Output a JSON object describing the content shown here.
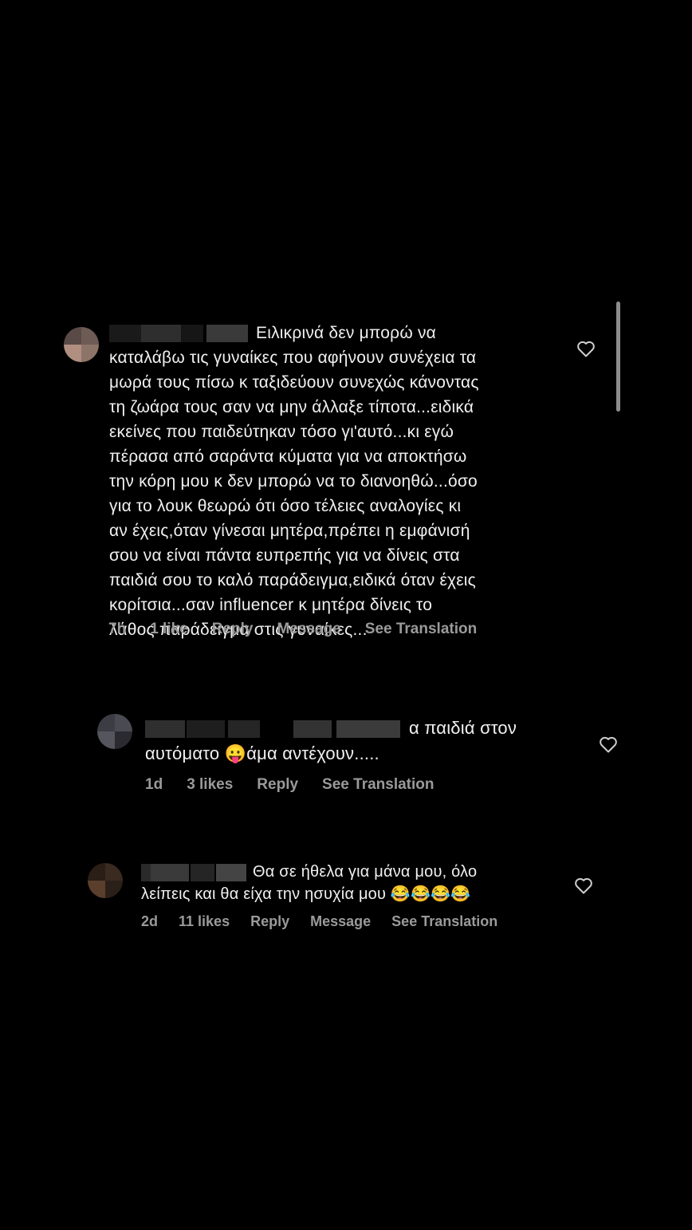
{
  "comments": [
    {
      "text_first": "Ειλικρινά δεν μπορώ να",
      "text_rest": "καταλάβω τις γυναίκες που αφήνουν συνέχεια τα\nμωρά τους πίσω κ ταξιδεύουν συνεχώς κάνοντας\nτη ζωάρα τους σαν να μην άλλαξε τίποτα...ειδικά\nεκείνες που παιδεύτηκαν τόσο γι'αυτό...κι εγώ\nπέρασα από σαράντα κύματα για να αποκτήσω\nτην κόρη μου κ δεν μπορώ να το διανοηθώ...όσο\nγια το λουκ θεωρώ ότι όσο τέλειες αναλογίες κι\nαν έχεις,όταν γίνεσαι μητέρα,πρέπει η εμφάνισή\nσου να είναι πάντα ευπρεπής για να δίνεις στα\nπαιδιά σου το καλό παράδειγμα,ειδικά όταν έχεις\nκορίτσια...σαν influencer κ μητέρα δίνεις το\nλάθος παράδειγμα στις γυναίκες...",
      "time": "7h",
      "likes": "1 like",
      "reply": "Reply",
      "message": "Message",
      "translate": "See Translation"
    },
    {
      "text_first": "α παιδιά στον",
      "text_rest": "αυτόματο 😛άμα αντέχουν.....",
      "time": "1d",
      "likes": "3 likes",
      "reply": "Reply",
      "translate": "See Translation"
    },
    {
      "text_first": "Θα σε ήθελα για μάνα μου, όλο",
      "text_rest": "λείπεις και θα είχα την ησυχία μου 😂😂😂😂",
      "time": "2d",
      "likes": "11 likes",
      "reply": "Reply",
      "message": "Message",
      "translate": "See Translation"
    }
  ],
  "colors": {
    "background": "#000000",
    "text": "#f0f0f0",
    "meta": "#9a9a9a",
    "heart": "#cfcfcf"
  },
  "icons": {
    "like": "heart-outline-icon"
  }
}
